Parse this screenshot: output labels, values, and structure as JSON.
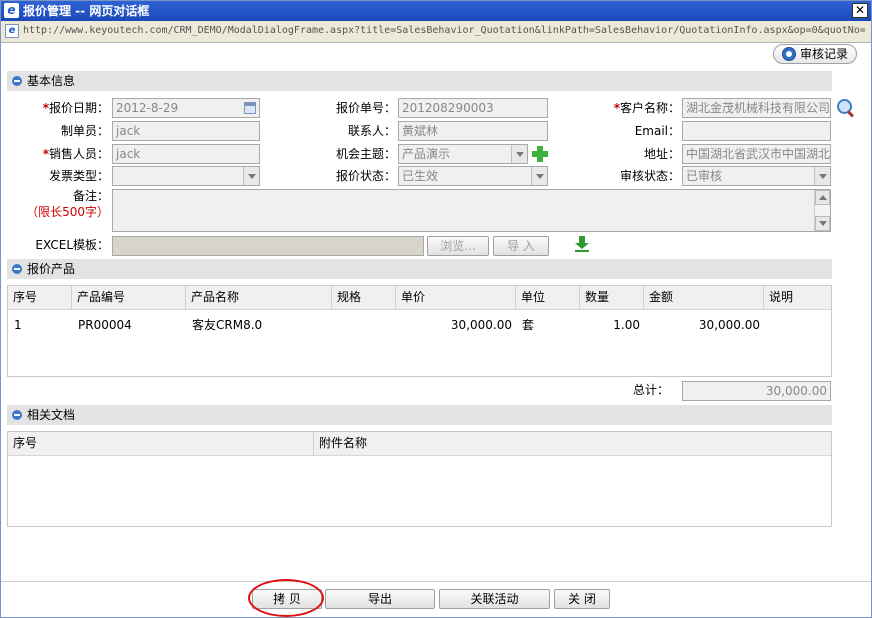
{
  "window": {
    "title": "报价管理 -- 网页对话框",
    "url": "http://www.keyoutech.com/CRM_DEMO/ModalDialogFrame.aspx?title=SalesBehavior_Quotation&linkPath=SalesBehavior/QuotationInfo.aspx&op=0&quotNo="
  },
  "toolbar": {
    "audit_record_label": "审核记录"
  },
  "basic_info": {
    "header": "基本信息",
    "quote_date_label": "报价日期：",
    "quote_date_value": "2012-8-29",
    "quote_no_label": "报价单号：",
    "quote_no_value": "201208290003",
    "customer_label": "客户名称：",
    "customer_value": "湖北金茂机械科技有限公司",
    "creator_label": "制单员：",
    "creator_value": "jack",
    "contact_label": "联系人：",
    "contact_value": "黄斌林",
    "email_label": "Email：",
    "email_value": "",
    "sales_label": "销售人员：",
    "sales_value": "jack",
    "opportunity_label": "机会主题：",
    "opportunity_value": "产品演示",
    "address_label": "地址：",
    "address_value": "中国湖北省武汉市中国湖北",
    "invoice_type_label": "发票类型：",
    "invoice_type_value": "",
    "quote_status_label": "报价状态：",
    "quote_status_value": "已生效",
    "audit_status_label": "审核状态：",
    "audit_status_value": "已审核",
    "remark_label": "备注：",
    "remark_limit": "（限长500字）",
    "excel_label": "EXCEL模板：",
    "browse_label": "浏览...",
    "import_label": "导 入",
    "required_mark": "*"
  },
  "products": {
    "header": "报价产品",
    "columns": [
      "序号",
      "产品编号",
      "产品名称",
      "规格",
      "单价",
      "单位",
      "数量",
      "金额",
      "说明"
    ],
    "rows": [
      {
        "no": "1",
        "code": "PR00004",
        "name": "客友CRM8.0",
        "spec": "",
        "price": "30,000.00",
        "unit": "套",
        "qty": "1.00",
        "amount": "30,000.00",
        "note": ""
      }
    ],
    "total_label": "总计：",
    "total_value": "30,000.00"
  },
  "documents": {
    "header": "相关文档",
    "columns": [
      "序号",
      "附件名称"
    ]
  },
  "footer": {
    "copy_label": "拷 贝",
    "export_label": "导出",
    "related_activity_label": "关联活动",
    "close_label": "关 闭"
  },
  "colors": {
    "title_bar": "#1c48b8",
    "required": "#d00000",
    "annotation_circle": "#e01010"
  }
}
